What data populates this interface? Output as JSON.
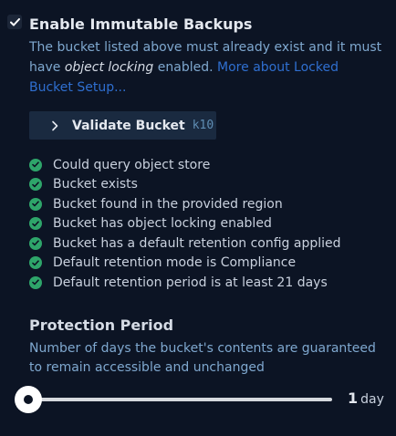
{
  "immutable": {
    "checked": true,
    "title": "Enable Immutable Backups",
    "desc_before": "The bucket listed above must already exist and it must have ",
    "desc_em": "object locking",
    "desc_after": " enabled. ",
    "link_text": "More about Locked Bucket Setup..."
  },
  "validate": {
    "label": "Validate Bucket",
    "tag": "k10",
    "icon": "chevron-right-icon"
  },
  "checks": [
    "Could query object store",
    "Bucket exists",
    "Bucket found in the provided region",
    "Bucket has object locking enabled",
    "Bucket has a default retention config applied",
    "Default retention mode is Compliance",
    "Default retention period is at least 21 days"
  ],
  "protection": {
    "title": "Protection Period",
    "description": "Number of days the bucket's contents are guaranteed to remain accessible and unchanged",
    "value": 1,
    "unit": "day",
    "min": 1,
    "min_fraction": 0.0
  },
  "colors": {
    "background": "#0c1424",
    "accent_link": "#2f6fd0",
    "success": "#2ea56a"
  }
}
